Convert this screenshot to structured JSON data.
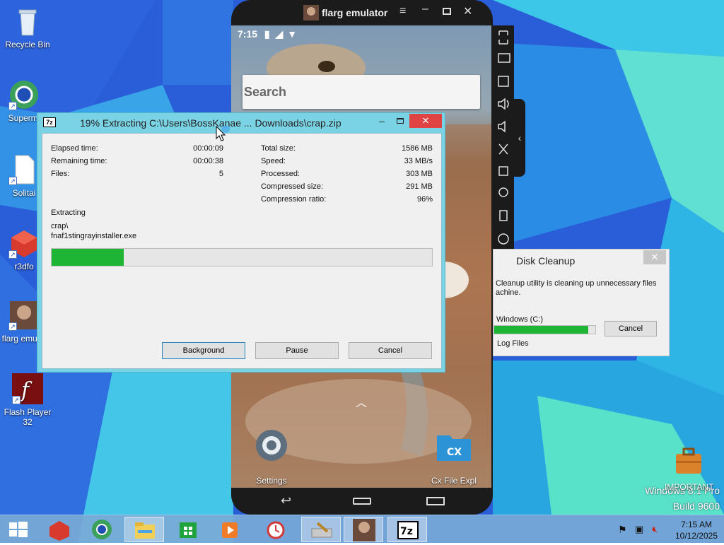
{
  "desktop": {
    "icons": [
      {
        "label": "Recycle Bin",
        "icon": "recycle-bin-icon"
      },
      {
        "label": "Supermi",
        "icon": "browser-globe-icon"
      },
      {
        "label": "Solitai",
        "icon": "blank-document-icon"
      },
      {
        "label": "r3dfo",
        "icon": "red-cube-icon"
      },
      {
        "label": "flarg emulat",
        "icon": "emulator-icon"
      },
      {
        "label": "Flash Player 32",
        "icon": "flash-player-icon"
      }
    ],
    "important_label": "IMPORTANT",
    "watermark_line1": "Windows 8.1 Pro",
    "watermark_line2": "Build 9600"
  },
  "emulator": {
    "title": "flarg emulator",
    "status_time": "7:15",
    "search_placeholder": "Search",
    "apps": [
      {
        "label": "Settings",
        "icon": "settings-gear-icon"
      },
      {
        "label": "Cx File Expl",
        "icon": "cx-file-explorer-icon"
      }
    ],
    "side_tools": [
      "fullscreen-icon",
      "keyboard-icon",
      "apk-icon",
      "volume-up-icon",
      "volume-down-icon",
      "screenshot-scissors-icon",
      "multi-instance-icon",
      "location-icon",
      "shake-icon",
      "settings-icon"
    ]
  },
  "zip_window": {
    "app_icon": "7z",
    "title": "19% Extracting C:\\Users\\BossKanae ... Downloads\\crap.zip",
    "progress_fraction": 0.19,
    "left_stats": [
      {
        "label": "Elapsed time:",
        "value": "00:00:09"
      },
      {
        "label": "Remaining time:",
        "value": "00:00:38"
      },
      {
        "label": "Files:",
        "value": "5"
      }
    ],
    "right_stats": [
      {
        "label": "Total size:",
        "value": "1586 MB"
      },
      {
        "label": "Speed:",
        "value": "33 MB/s"
      },
      {
        "label": "Processed:",
        "value": "303 MB"
      },
      {
        "label": "Compressed size:",
        "value": "291 MB"
      },
      {
        "label": "Compression ratio:",
        "value": "96%"
      }
    ],
    "status_label": "Extracting",
    "current_path_line1": "crap\\",
    "current_path_line2": "fnaf1stingrayinstaller.exe",
    "buttons": {
      "background": "Background",
      "pause": "Pause",
      "cancel": "Cancel"
    }
  },
  "disk_cleanup": {
    "title": "Disk Cleanup",
    "message_line1": "Cleanup utility is cleaning up unnecessary files",
    "message_line2": "achine.",
    "drive_label": "Windows (C:)",
    "progress_fraction": 0.93,
    "cancel_label": "Cancel",
    "current_item": "Log Files"
  },
  "taskbar": {
    "items": [
      "start-icon",
      "red-cube-app-icon",
      "browser-globe-app-icon",
      "file-explorer-icon",
      "store-icon",
      "media-player-icon",
      "alarm-clock-icon",
      "disk-cleanup-icon",
      "flarg-emulator-icon",
      "7zip-icon"
    ],
    "active_items": [
      "file-explorer-icon",
      "disk-cleanup-icon",
      "flarg-emulator-icon",
      "7zip-icon"
    ],
    "clock_time": "7:15 AM",
    "clock_date": "10/12/2025"
  },
  "colors": {
    "zip_accent": "#7ad3e4",
    "progress_green": "#1fb534",
    "close_red": "#e04343",
    "taskbar": "#78aad6"
  }
}
